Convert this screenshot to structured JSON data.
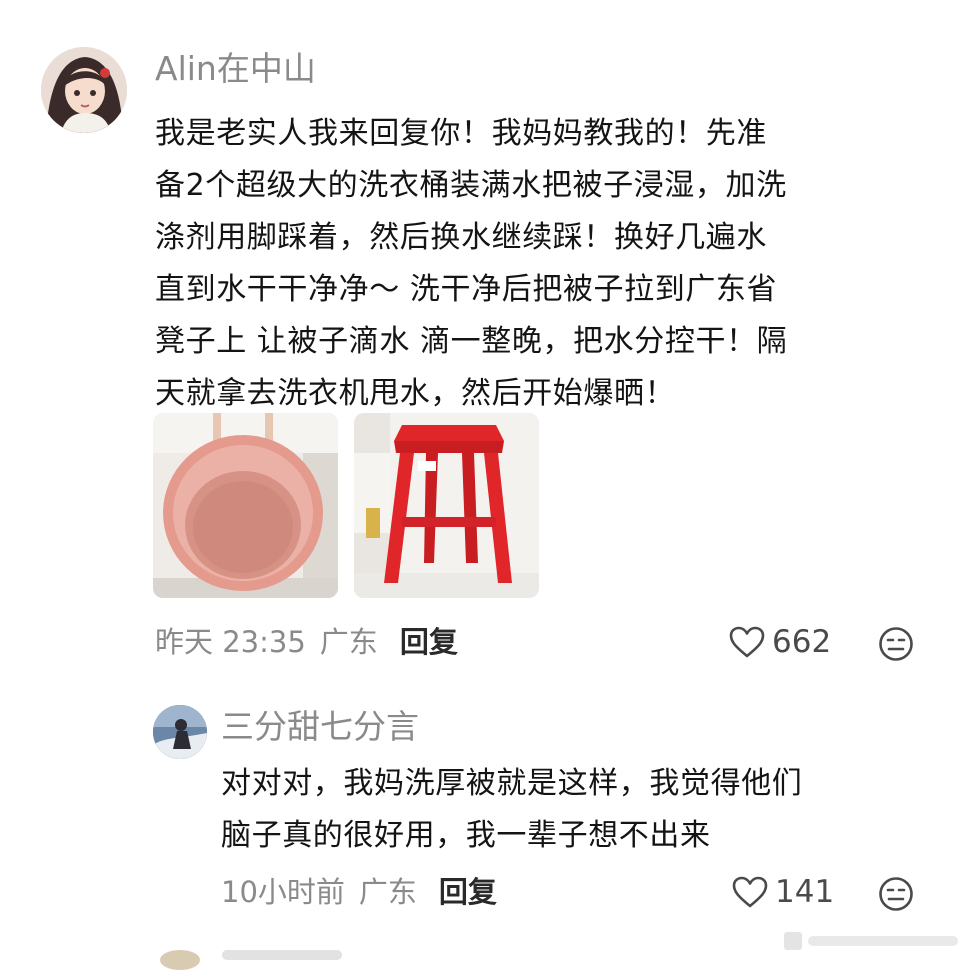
{
  "main_comment": {
    "username": "Alin在中山",
    "text_lines": [
      "我是老实人我来回复你！我妈妈教我的！先准",
      "备2个超级大的洗衣桶装满水把被子浸湿，加洗",
      "涤剂用脚踩着，然后换水继续踩！换好几遍水",
      "直到水干干净净～ 洗干净后把被子拉到广东省",
      "凳子上 让被子滴水 滴一整晚，把水分控干！隔",
      "天就拿去洗衣机甩水，然后开始爆晒！"
    ],
    "images": [
      {
        "icon": "pink-wash-basin-image"
      },
      {
        "icon": "red-plastic-stool-image"
      }
    ],
    "time": "昨天 23:35",
    "location": "广东",
    "reply_label": "回复",
    "likes": "662",
    "like_icon": "heart-outline-icon",
    "emoji_icon": "emoji-face-icon"
  },
  "reply_comment": {
    "username": "三分甜七分言",
    "text_lines": [
      "对对对，我妈洗厚被就是这样，我觉得他们",
      "脑子真的很好用，我一辈子想不出来"
    ],
    "time": "10小时前",
    "location": "广东",
    "reply_label": "回复",
    "likes": "141",
    "like_icon": "heart-outline-icon",
    "emoji_icon": "emoji-face-icon"
  },
  "colors": {
    "username": "#8a8a8a",
    "text": "#141414",
    "meta": "#8a8a8a",
    "reply_button": "#2a2a2a",
    "stool_red": "#e1262a",
    "basin_pink": "#e9a89c"
  }
}
